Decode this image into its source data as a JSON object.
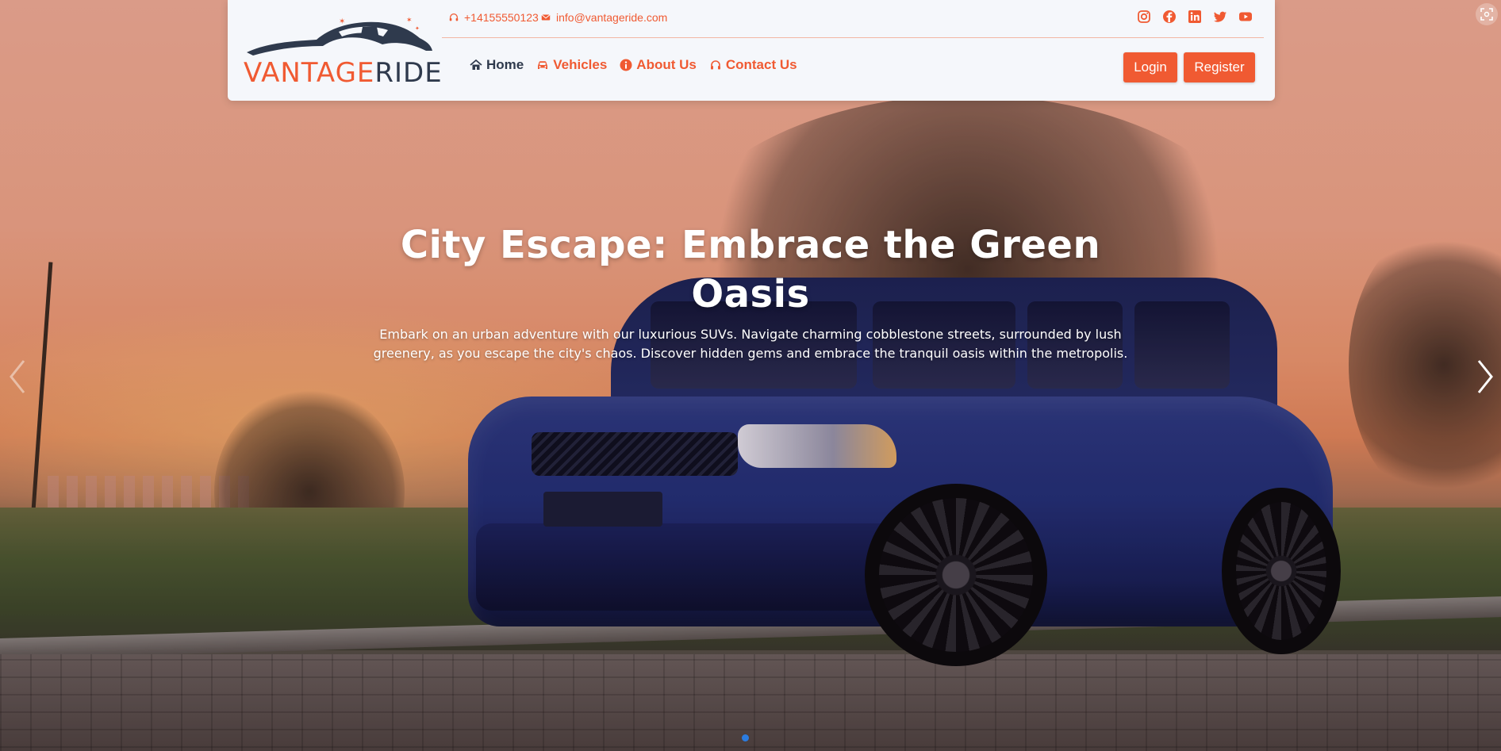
{
  "brand": {
    "logo_part1": "VANTAGE",
    "logo_part2": "RIDE",
    "accent_color": "#f05a32",
    "dark_color": "#2f3a4d"
  },
  "topbar": {
    "phone": "+14155550123",
    "email": "info@vantageride.com",
    "socials": [
      "instagram-icon",
      "facebook-icon",
      "linkedin-icon",
      "twitter-icon",
      "youtube-icon"
    ]
  },
  "nav": {
    "items": [
      {
        "label": "Home",
        "icon": "home-icon",
        "active": true
      },
      {
        "label": "Vehicles",
        "icon": "car-icon",
        "active": false
      },
      {
        "label": "About Us",
        "icon": "info-icon",
        "active": false
      },
      {
        "label": "Contact Us",
        "icon": "headset-icon",
        "active": false
      }
    ]
  },
  "auth": {
    "login_label": "Login",
    "register_label": "Register"
  },
  "hero": {
    "title": "City Escape: Embrace the Green Oasis",
    "description": "Embark on an urban adventure with our luxurious SUVs. Navigate charming cobblestone streets, surrounded by lush greenery, as you escape the city's chaos. Discover hidden gems and embrace the tranquil oasis within the metropolis.",
    "slide_count": 1,
    "active_slide": 1
  }
}
